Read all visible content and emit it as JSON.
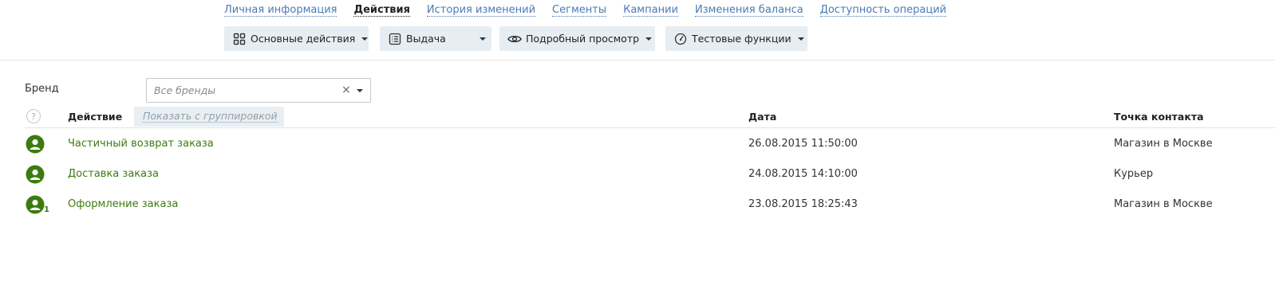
{
  "tabs": [
    {
      "label": "Личная информация",
      "active": false
    },
    {
      "label": "Действия",
      "active": true
    },
    {
      "label": "История изменений",
      "active": false
    },
    {
      "label": "Сегменты",
      "active": false
    },
    {
      "label": "Кампании",
      "active": false
    },
    {
      "label": "Изменения баланса",
      "active": false
    },
    {
      "label": "Доступность операций",
      "active": false
    }
  ],
  "toolbar": {
    "main_actions": {
      "label": "Основные действия",
      "icon": "grid-icon"
    },
    "issue": {
      "label": "Выдача",
      "icon": "list-icon"
    },
    "details": {
      "label": "Подробный просмотр",
      "icon": "eye-icon"
    },
    "test": {
      "label": "Тестовые функции",
      "icon": "gauge-icon"
    }
  },
  "filter": {
    "brand_label": "Бренд",
    "brand_placeholder": "Все бренды",
    "clear_glyph": "×"
  },
  "table": {
    "help_glyph": "?",
    "col_action": "Действие",
    "group_link": "Показать с группировкой",
    "col_date": "Дата",
    "col_contact": "Точка контакта",
    "rows": [
      {
        "action": "Частичный возврат заказа",
        "date": "26.08.2015 11:50:00",
        "contact": "Магазин в Москве",
        "badge": ""
      },
      {
        "action": "Доставка заказа",
        "date": "24.08.2015 14:10:00",
        "contact": "Курьер",
        "badge": ""
      },
      {
        "action": "Оформление заказа",
        "date": "23.08.2015 18:25:43",
        "contact": "Магазин в Москве",
        "badge": "1"
      }
    ]
  },
  "colors": {
    "accent_green": "#3d7a10",
    "link_blue": "#4a7ab5",
    "button_bg": "#e6edf3"
  }
}
